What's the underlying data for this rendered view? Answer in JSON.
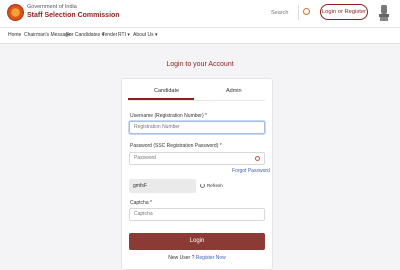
{
  "header": {
    "gov_text": "Government of India",
    "org_name": "Staff Selection Commission",
    "search_placeholder": "Search",
    "login_register": "Login or Register"
  },
  "nav": {
    "items": [
      "Home",
      "Chairman's Message",
      "For Candidates ▾",
      "Tender",
      "RTI ▾",
      "About Us ▾"
    ]
  },
  "page": {
    "title": "Login to your Account"
  },
  "tabs": {
    "candidate": "Candidate",
    "admin": "Admin"
  },
  "form": {
    "username_label": "Username (Registration Number) *",
    "username_placeholder": "Registration Number",
    "password_label": "Password (SSC Registration Password) *",
    "password_placeholder": "Password",
    "forgot_password": "Forgot Password",
    "captcha_code": "gmfsF",
    "refresh_label": "Refresh",
    "captcha_label": "Captcha *",
    "captcha_placeholder": "Captcha",
    "login_button": "Login",
    "new_user_text": "New User ?",
    "register_link": "Register Now"
  },
  "colors": {
    "brand": "#8a1e1e",
    "button": "#8b3a36",
    "link": "#3c5fb0"
  }
}
